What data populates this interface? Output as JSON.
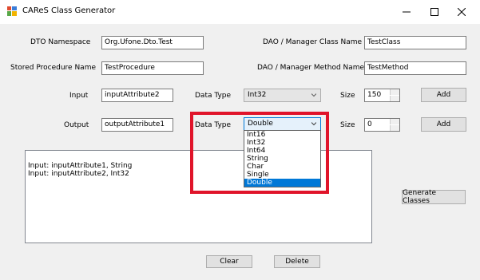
{
  "window": {
    "title": "CAReS Class Generator"
  },
  "form": {
    "dto_namespace_label": "DTO Namespace",
    "dto_namespace_value": "Org.Ufone.Dto.Test",
    "dao_class_label": "DAO /  Manager Class Name",
    "dao_class_value": "TestClass",
    "stored_proc_label": "Stored Procedure Name",
    "stored_proc_value": "TestProcedure",
    "dao_method_label": "DAO /  Manager Method Name",
    "dao_method_value": "TestMethod",
    "input_label": "Input",
    "input_value": "inputAttribute2",
    "input_type_label": "Data Type",
    "input_type_value": "Int32",
    "input_size_label": "Size",
    "input_size_value": "150",
    "input_add_label": "Add",
    "output_label": "Output",
    "output_value": "outputAttribute1",
    "output_type_label": "Data Type",
    "output_type_value": "Double",
    "output_size_label": "Size",
    "output_size_value": "0",
    "output_add_label": "Add"
  },
  "dropdown_options": [
    "Int16",
    "Int32",
    "Int64",
    "String",
    "Char",
    "Single",
    "Double"
  ],
  "dropdown_selected": "Double",
  "attributes_list": [
    "Input: inputAttribute1, String",
    "Input: inputAttribute2, Int32"
  ],
  "buttons": {
    "generate": "Generate Classes",
    "clear": "Clear",
    "delete": "Delete"
  },
  "colors": {
    "highlight": "#0078d7",
    "annotation_box": "#e0142a"
  },
  "icons": {
    "app": "app-icon",
    "minimize": "minimize-icon",
    "maximize": "maximize-icon",
    "close": "close-icon"
  }
}
